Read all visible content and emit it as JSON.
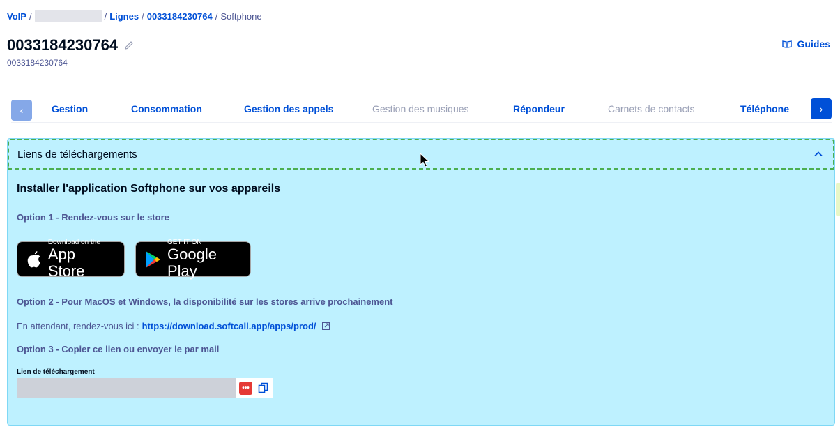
{
  "breadcrumb": {
    "voip": "VoIP",
    "sep1": "/",
    "sep2": "/",
    "lignes": "Lignes",
    "sep3": "/",
    "line": "0033184230764",
    "sep4": "/",
    "current": "Softphone"
  },
  "header": {
    "title": "0033184230764",
    "subtitle": "0033184230764",
    "guides_label": "Guides"
  },
  "tabs": [
    {
      "label": "Gestion",
      "enabled": true
    },
    {
      "label": "Consommation",
      "enabled": true
    },
    {
      "label": "Gestion des appels",
      "enabled": true
    },
    {
      "label": "Gestion des musiques",
      "enabled": false
    },
    {
      "label": "Répondeur",
      "enabled": true
    },
    {
      "label": "Carnets de contacts",
      "enabled": false
    },
    {
      "label": "Téléphone",
      "enabled": true
    }
  ],
  "panel": {
    "header_label": "Liens de téléchargements",
    "heading": "Installer l'application Softphone sur vos appareils",
    "option1": "Option 1 - Rendez-vous sur le store",
    "app_store": {
      "small": "Download on the",
      "big": "App Store"
    },
    "google_play": {
      "small": "GET IT ON",
      "big": "Google Play"
    },
    "option2": "Option 2 - Pour MacOS et Windows, la disponibilité sur les stores arrive prochainement",
    "waiting_text": "En attendant, rendez-vous ici :",
    "download_url": "https://download.softcall.app/apps/prod/",
    "option3": "Option 3 - Copier ce lien ou envoyer le par mail",
    "field_label": "Lien de téléchargement"
  },
  "colors": {
    "accent": "#0050d7",
    "panel_bg": "#bef1ff",
    "text": "#4d5693",
    "heading": "#000d1f"
  }
}
